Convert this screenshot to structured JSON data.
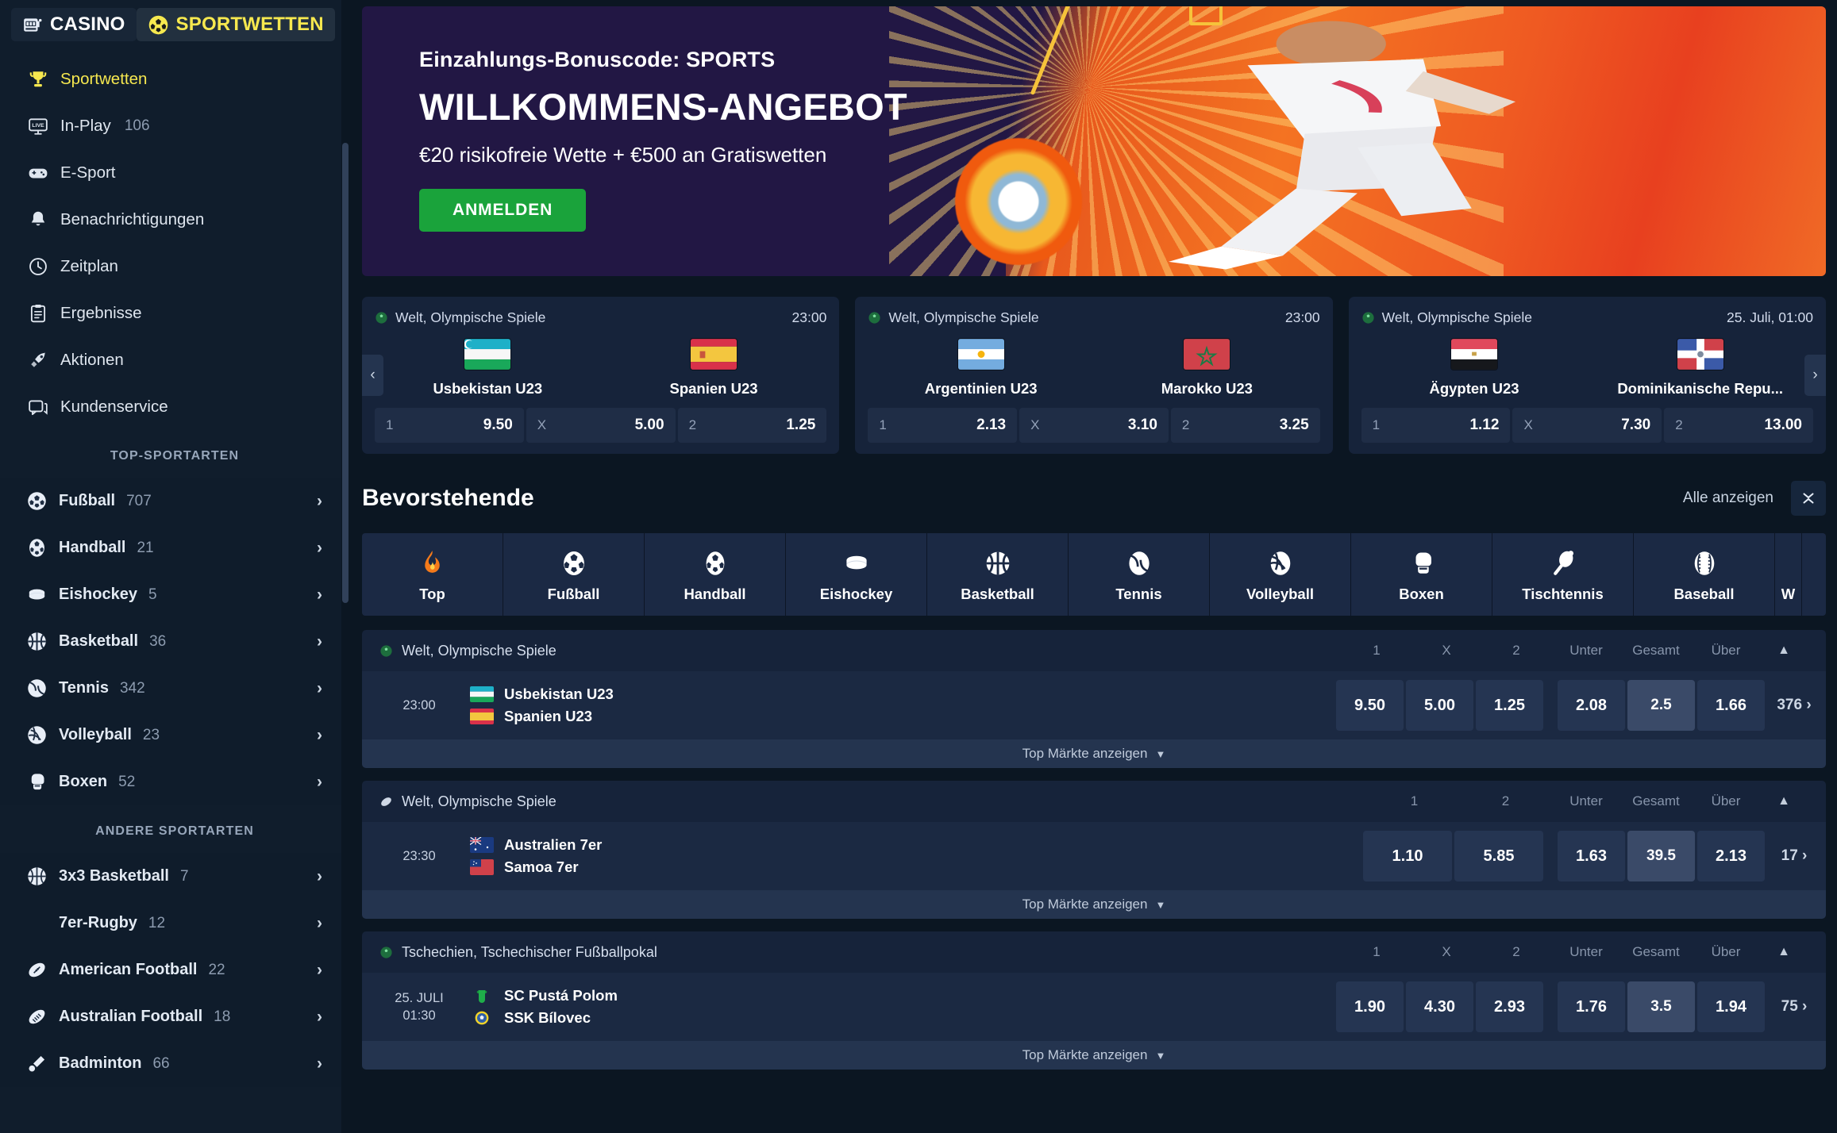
{
  "brand": {
    "casino": "CASINO",
    "sports": "SPORTWETTEN"
  },
  "nav": {
    "items": [
      {
        "label": "Sportwetten",
        "icon": "trophy-icon",
        "count": "",
        "active": true
      },
      {
        "label": "In-Play",
        "icon": "live-tv-icon",
        "count": "106",
        "active": false
      },
      {
        "label": "E-Sport",
        "icon": "gamepad-icon",
        "count": "",
        "active": false
      },
      {
        "label": "Benachrichtigungen",
        "icon": "bell-icon",
        "count": "",
        "active": false
      },
      {
        "label": "Zeitplan",
        "icon": "clock-icon",
        "count": "",
        "active": false
      },
      {
        "label": "Ergebnisse",
        "icon": "clipboard-icon",
        "count": "",
        "active": false
      },
      {
        "label": "Aktionen",
        "icon": "rocket-icon",
        "count": "",
        "active": false
      },
      {
        "label": "Kundenservice",
        "icon": "chat-icon",
        "count": "",
        "active": false
      }
    ]
  },
  "top_sports": {
    "title": "TOP-SPORTARTEN",
    "items": [
      {
        "label": "Fußball",
        "count": "707",
        "icon": "soccer-ball-icon"
      },
      {
        "label": "Handball",
        "count": "21",
        "icon": "handball-icon"
      },
      {
        "label": "Eishockey",
        "count": "5",
        "icon": "hockey-puck-icon"
      },
      {
        "label": "Basketball",
        "count": "36",
        "icon": "basketball-icon"
      },
      {
        "label": "Tennis",
        "count": "342",
        "icon": "tennis-ball-icon"
      },
      {
        "label": "Volleyball",
        "count": "23",
        "icon": "volleyball-icon"
      },
      {
        "label": "Boxen",
        "count": "52",
        "icon": "boxing-glove-icon"
      }
    ]
  },
  "other_sports": {
    "title": "ANDERE SPORTARTEN",
    "items": [
      {
        "label": "3x3 Basketball",
        "count": "7",
        "icon": "basketball-icon"
      },
      {
        "label": "7er-Rugby",
        "count": "12",
        "icon": "rugby-icon"
      },
      {
        "label": "American Football",
        "count": "22",
        "icon": "american-football-icon"
      },
      {
        "label": "Australian Football",
        "count": "18",
        "icon": "australian-football-icon"
      },
      {
        "label": "Badminton",
        "count": "66",
        "icon": "shuttlecock-icon"
      }
    ]
  },
  "banner": {
    "code": "Einzahlungs-Bonuscode: SPORTS",
    "title": "WILLKOMMENS-ANGEBOT",
    "subtitle": "€20 risikofreie Wette + €500 an Gratiswetten",
    "cta": "ANMELDEN",
    "cta_color": "#1aa33b"
  },
  "featured_cards": [
    {
      "league": "Welt, Olympische Spiele",
      "time": "23:00",
      "home": {
        "name": "Usbekistan U23",
        "flag": "uz"
      },
      "away": {
        "name": "Spanien U23",
        "flag": "es"
      },
      "odds": [
        {
          "key": "1",
          "value": "9.50"
        },
        {
          "key": "X",
          "value": "5.00"
        },
        {
          "key": "2",
          "value": "1.25"
        }
      ]
    },
    {
      "league": "Welt, Olympische Spiele",
      "time": "23:00",
      "home": {
        "name": "Argentinien U23",
        "flag": "ar"
      },
      "away": {
        "name": "Marokko U23",
        "flag": "ma"
      },
      "odds": [
        {
          "key": "1",
          "value": "2.13"
        },
        {
          "key": "X",
          "value": "3.10"
        },
        {
          "key": "2",
          "value": "3.25"
        }
      ]
    },
    {
      "league": "Welt, Olympische Spiele",
      "time": "25. Juli, 01:00",
      "home": {
        "name": "Ägypten U23",
        "flag": "eg"
      },
      "away": {
        "name": "Dominikanische Repu...",
        "flag": "do"
      },
      "odds": [
        {
          "key": "1",
          "value": "1.12"
        },
        {
          "key": "X",
          "value": "7.30"
        },
        {
          "key": "2",
          "value": "13.00"
        }
      ]
    }
  ],
  "upcoming": {
    "title": "Bevorstehende",
    "show_all": "Alle anzeigen",
    "collapse_icon": "collapse-icon",
    "tabs": [
      {
        "label": "Top",
        "icon": "flame-icon",
        "active": true
      },
      {
        "label": "Fußball",
        "icon": "soccer-ball-icon",
        "active": false
      },
      {
        "label": "Handball",
        "icon": "handball-icon",
        "active": false
      },
      {
        "label": "Eishockey",
        "icon": "hockey-puck-icon",
        "active": false
      },
      {
        "label": "Basketball",
        "icon": "basketball-icon",
        "active": false
      },
      {
        "label": "Tennis",
        "icon": "tennis-ball-icon",
        "active": false
      },
      {
        "label": "Volleyball",
        "icon": "volleyball-icon",
        "active": false
      },
      {
        "label": "Boxen",
        "icon": "boxing-glove-icon",
        "active": false
      },
      {
        "label": "Tischtennis",
        "icon": "table-tennis-icon",
        "active": false
      },
      {
        "label": "Baseball",
        "icon": "baseball-icon",
        "active": false
      },
      {
        "label": "W",
        "icon": "partial-icon",
        "active": false
      }
    ],
    "top_markets_label": "Top Märkte anzeigen",
    "groups": [
      {
        "league": "Welt, Olympische Spiele",
        "league_icon": "soccer-ball-icon",
        "columns": [
          "1",
          "X",
          "2",
          "Unter",
          "Gesamt",
          "Über"
        ],
        "events": [
          {
            "time_line1": "23:00",
            "time_line2": "",
            "home": {
              "name": "Usbekistan U23",
              "flag": "uz"
            },
            "away": {
              "name": "Spanien U23",
              "flag": "es"
            },
            "odds1x2": [
              "9.50",
              "5.00",
              "1.25"
            ],
            "under": "2.08",
            "total": "2.5",
            "over": "1.66",
            "more_count": "376"
          }
        ]
      },
      {
        "league": "Welt, Olympische Spiele",
        "league_icon": "rugby-icon",
        "columns": [
          "1",
          "2",
          "Unter",
          "Gesamt",
          "Über"
        ],
        "events": [
          {
            "time_line1": "23:30",
            "time_line2": "",
            "home": {
              "name": "Australien 7er",
              "flag": "au"
            },
            "away": {
              "name": "Samoa 7er",
              "flag": "ws"
            },
            "odds1x2": [
              "1.10",
              "5.85"
            ],
            "under": "1.63",
            "total": "39.5",
            "over": "2.13",
            "more_count": "17"
          }
        ]
      },
      {
        "league": "Tschechien, Tschechischer Fußballpokal",
        "league_icon": "soccer-ball-icon",
        "columns": [
          "1",
          "X",
          "2",
          "Unter",
          "Gesamt",
          "Über"
        ],
        "events": [
          {
            "time_line1": "25. JULI",
            "time_line2": "01:30",
            "home": {
              "name": "SC Pustá Polom",
              "flag": "crest-green"
            },
            "away": {
              "name": "SSK Bílovec",
              "flag": "crest-yellow"
            },
            "odds1x2": [
              "1.90",
              "4.30",
              "2.93"
            ],
            "under": "1.76",
            "total": "3.5",
            "over": "1.94",
            "more_count": "75"
          }
        ]
      }
    ]
  },
  "colors": {
    "accent_yellow": "#f6e84f",
    "cta_green": "#1aa33b",
    "sidebar_bg": "#101d2c",
    "page_bg": "#0b1622",
    "card_bg": "#16233a",
    "row_bg": "#1b2942"
  }
}
